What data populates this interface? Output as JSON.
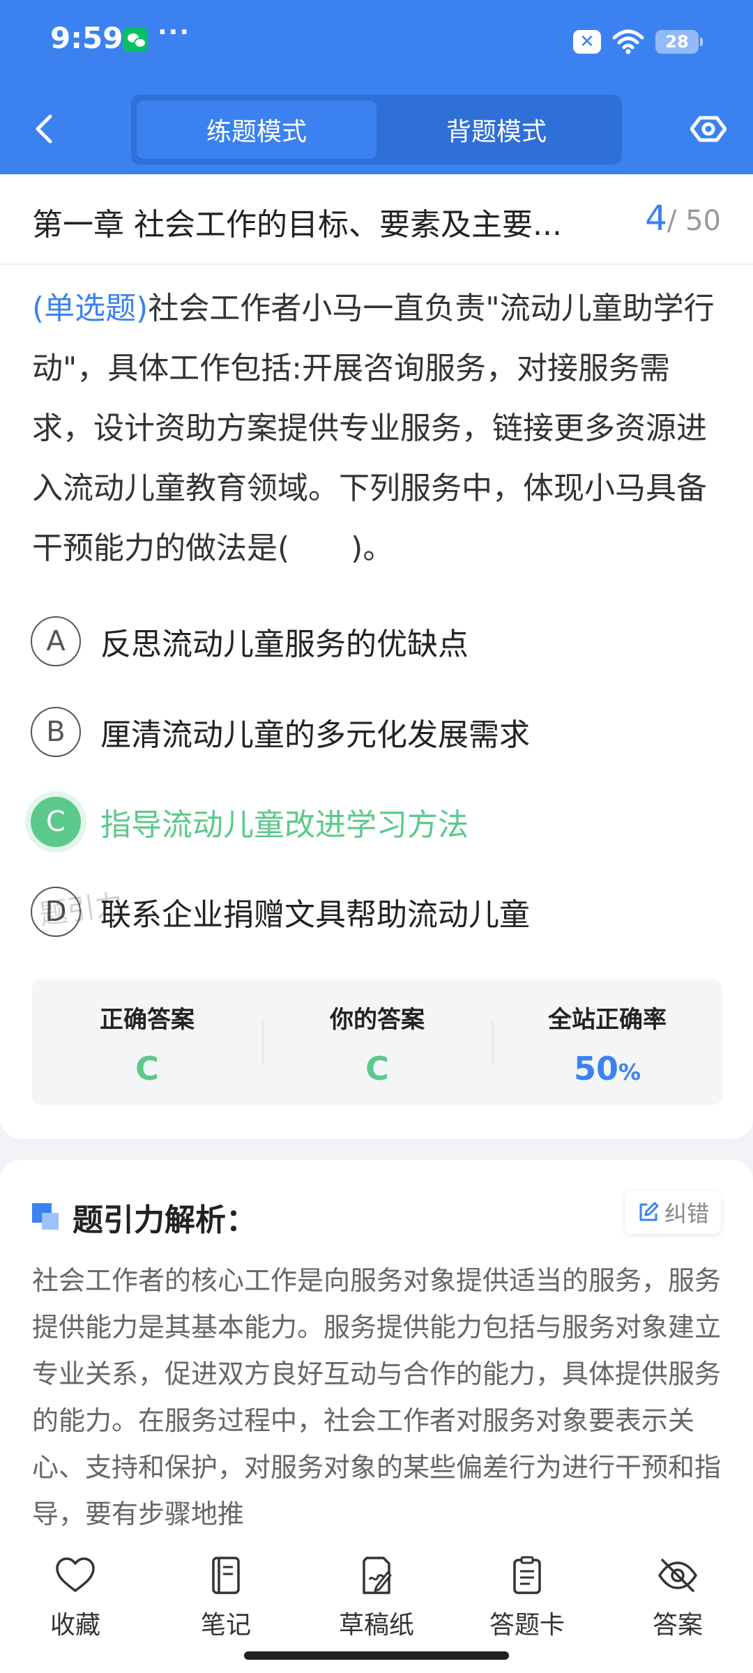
{
  "status_bar": {
    "time": "9:59",
    "more": "···",
    "battery": "28"
  },
  "header": {
    "tabs": [
      "练题模式",
      "背题模式"
    ]
  },
  "chapter": {
    "title": "第一章 社会工作的目标、要素及主要...",
    "current": "4",
    "total": "/ 50"
  },
  "question": {
    "type": "(单选题)",
    "text": "社会工作者小马一直负责\"流动儿童助学行动\"，具体工作包括:开展咨询服务，对接服务需求，设计资助方案提供专业服务，链接更多资源进入流动儿童教育领域。下列服务中，体现小马具备干预能力的做法是(　　)。"
  },
  "options": [
    {
      "letter": "A",
      "text": "反思流动儿童服务的优缺点"
    },
    {
      "letter": "B",
      "text": "厘清流动儿童的多元化发展需求"
    },
    {
      "letter": "C",
      "text": "指导流动儿童改进学习方法"
    },
    {
      "letter": "D",
      "text": "联系企业捐赠文具帮助流动儿童"
    }
  ],
  "watermark": "题引力",
  "result": {
    "correct_label": "正确答案",
    "correct_value": "C",
    "yours_label": "你的答案",
    "yours_value": "C",
    "rate_label": "全站正确率",
    "rate_value": "50",
    "rate_unit": "%"
  },
  "analysis": {
    "title": "题引力解析：",
    "report_label": "纠错",
    "text": "社会工作者的核心工作是向服务对象提供适当的服务，服务提供能力是其基本能力。服务提供能力包括与服务对象建立专业关系，促进双方良好互动与合作的能力，具体提供服务的能力。在服务过程中，社会工作者对服务对象要表示关心、支持和保护，对服务对象的某些偏差行为进行干预和指导，要有步骤地推"
  },
  "toolbar": {
    "items": [
      "收藏",
      "笔记",
      "草稿纸",
      "答题卡",
      "答案"
    ]
  },
  "colors": {
    "brand": "#3b82f0",
    "correct": "#5bc98a"
  }
}
